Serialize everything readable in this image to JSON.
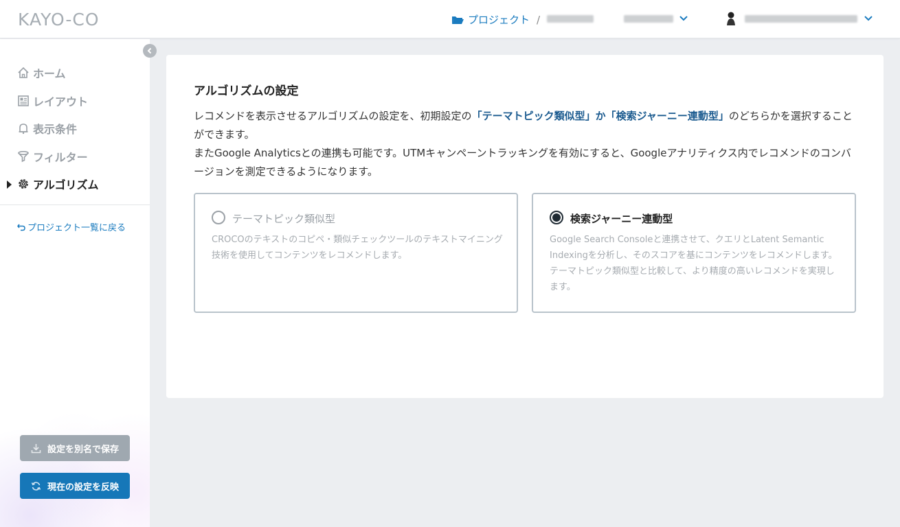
{
  "header": {
    "logo": "KAYO-CO",
    "breadcrumb_project_link": "プロジェクト",
    "breadcrumb_sep": "/"
  },
  "sidebar": {
    "items": [
      {
        "label": "ホーム",
        "icon": "home-icon"
      },
      {
        "label": "レイアウト",
        "icon": "layout-icon"
      },
      {
        "label": "表示条件",
        "icon": "bell-icon"
      },
      {
        "label": "フィルター",
        "icon": "filter-icon"
      },
      {
        "label": "アルゴリズム",
        "icon": "gear-icon",
        "active": true
      }
    ],
    "back_link": "プロジェクト一覧に戻る",
    "save_as_label": "設定を別名で保存",
    "apply_label": "現在の設定を反映"
  },
  "main": {
    "title": "アルゴリズムの設定",
    "desc_p1_a": "レコメンドを表示させるアルゴリズムの設定を、初期設定の",
    "desc_p1_hl": "「テーマトピック類似型」か「検索ジャーニー連動型」",
    "desc_p1_b": "のどちらかを選択することができます。",
    "desc_p2": "またGoogle Analyticsとの連携も可能です。UTMキャンペーントラッキングを有効にすると、Googleアナリティクス内でレコメンドのコンバージョンを測定できるようになります。",
    "options": [
      {
        "title": "テーマトピック類似型",
        "text": "CROCOのテキストのコピペ・類似チェックツールのテキストマイニング技術を使用してコンテンツをレコメンドします。",
        "selected": false
      },
      {
        "title": "検索ジャーニー連動型",
        "text": "Google Search Consoleと連携させて、クエリとLatent Semantic Indexingを分析し、そのスコアを基にコンテンツをレコメンドします。テーマトピック類似型と比較して、より精度の高いレコメンドを実現します。",
        "selected": true
      }
    ]
  },
  "colors": {
    "accent": "#1a7bbf",
    "apply_button": "#1677b8",
    "save_button": "#9fa8b0"
  }
}
